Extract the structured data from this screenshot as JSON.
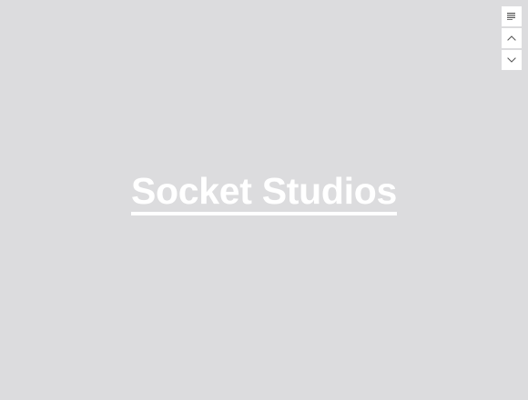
{
  "brand": {
    "title": "Socket Studios"
  },
  "nav": {
    "menu_icon": "menu-lines-icon",
    "prev_icon": "chevron-up-icon",
    "next_icon": "chevron-down-icon"
  },
  "colors": {
    "background": "#dcdcde",
    "text": "#ffffff",
    "icon": "#555555",
    "button": "#ffffff"
  }
}
